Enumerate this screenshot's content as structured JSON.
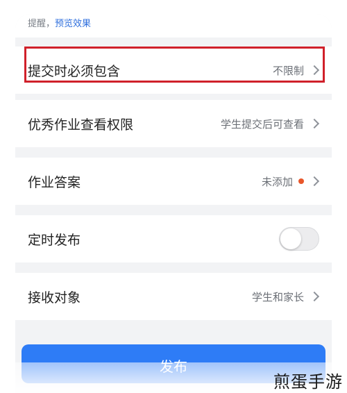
{
  "hint": {
    "prefix": "提醒，",
    "link": "预览效果"
  },
  "rows": [
    {
      "title": "提交时必须包含",
      "value": "不限制"
    },
    {
      "title": "优秀作业查看权限",
      "value": "学生提交后可查看"
    },
    {
      "title": "作业答案",
      "value": "未添加"
    },
    {
      "title": "定时发布"
    },
    {
      "title": "接收对象",
      "value": "学生和家长"
    }
  ],
  "publish_label": "发布",
  "watermark": "煎蛋手游",
  "colors": {
    "accent": "#2e7cf6",
    "highlight": "#d0202a",
    "badge": "#e8562a"
  },
  "icons": {
    "chevron": "chevron-right-icon",
    "dot": "red-dot-icon"
  },
  "toggle": {
    "on": false
  }
}
